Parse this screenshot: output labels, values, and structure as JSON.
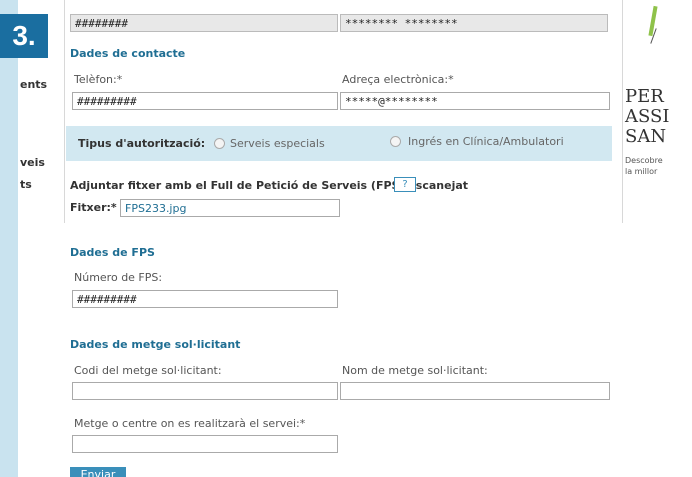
{
  "step": "3.",
  "left_sidebar": {
    "items": [
      "ents",
      "veis",
      "ts"
    ]
  },
  "right_ad": {
    "lines": [
      "PER",
      "ASSI",
      "SAN"
    ],
    "sub": [
      "Descobre",
      "la millor"
    ]
  },
  "top_row": {
    "left_value": "########",
    "right_value": "******** ********"
  },
  "contact": {
    "title": "Dades de contacte",
    "phone_label": "Telèfon:*",
    "phone_value": "#########",
    "email_label": "Adreça electrònica:*",
    "email_value": "*****@********"
  },
  "authorization": {
    "label": "Tipus d'autorització:",
    "option_1": "Serveis especials",
    "option_2": "Ingrés en Clínica/Ambulatori"
  },
  "attachment": {
    "label": "Adjuntar fitxer amb el Full de Petició de Serveis (FPS) escanejat",
    "help": "?",
    "file_label": "Fitxer:*",
    "file_value": "FPS233.jpg"
  },
  "fps": {
    "title": "Dades de FPS",
    "number_label": "Número de FPS:",
    "number_value": "#########"
  },
  "doctor": {
    "title": "Dades de metge sol·licitant",
    "code_label": "Codi del metge sol·licitant:",
    "code_value": "",
    "name_label": "Nom de metge sol·licitant:",
    "name_value": "",
    "center_label": "Metge o centre on es realitzarà el servei:*",
    "center_value": ""
  },
  "submit_label": "Enviar"
}
